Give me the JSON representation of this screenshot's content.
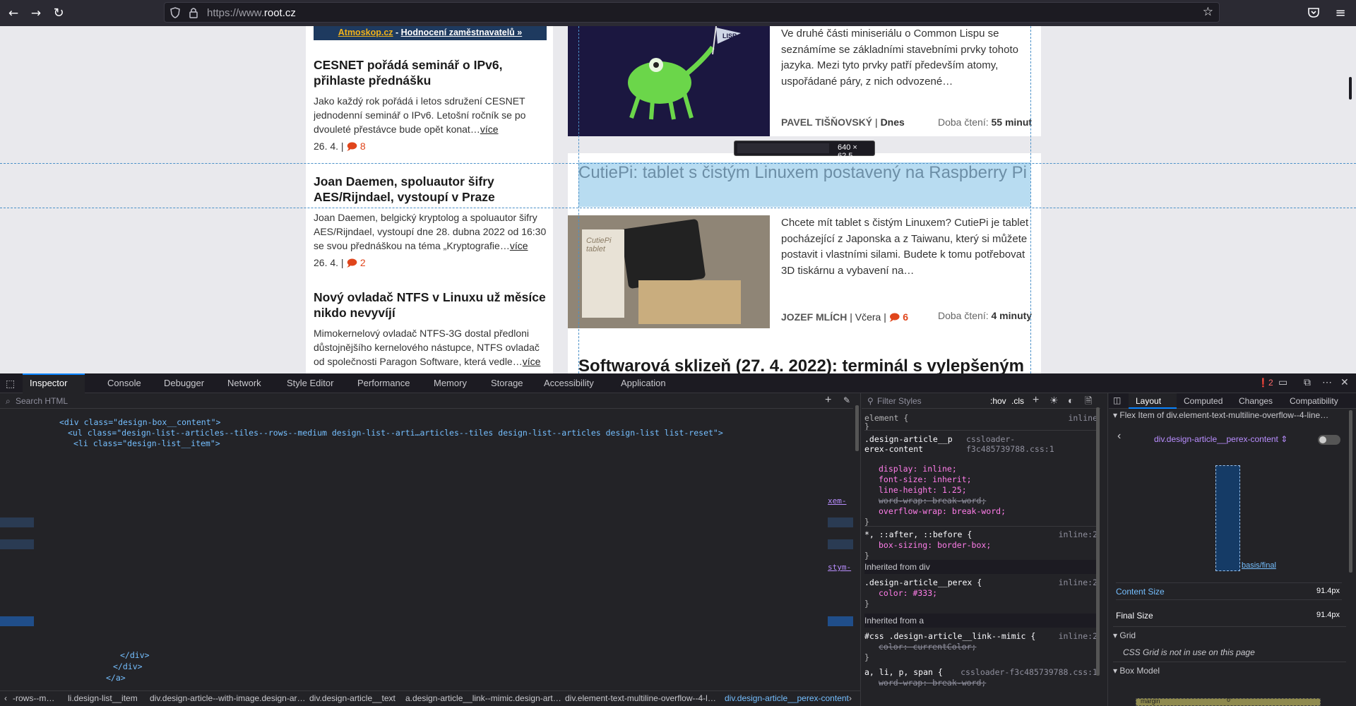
{
  "browser": {
    "url_prefix": "https://www.",
    "url_domain": "root.cz"
  },
  "page": {
    "promo": {
      "link1": "Atmoskop.cz",
      "sep": " - ",
      "link2": "Hodnocení zaměstnavatelů »"
    },
    "left_articles": [
      {
        "title": "CESNET pořádá seminář o IPv6, přihlaste přednášku",
        "perex": "Jako každý rok pořádá i letos sdružení CESNET jednodenní seminář o IPv6. Letošní ročník se po dvouleté přestávce bude opět konat…",
        "more": "více",
        "date": "26. 4.",
        "comments": "8"
      },
      {
        "title": "Joan Daemen, spoluautor šifry AES/Rijndael, vystoupí v Praze",
        "perex": "Joan Daemen, belgický kryptolog a spoluautor šifry AES/Rijndael, vystoupí dne 28. dubna 2022 od 16:30 se svou přednáškou na téma „Kryptografie…",
        "more": "více",
        "date": "26. 4.",
        "comments": "2"
      },
      {
        "title": "Nový ovladač NTFS v Linuxu už měsíce nikdo nevyvíjí",
        "perex": "Mimokernelový ovladač NTFS-3G dostal předloni důstojnějšího kernelového nástupce, NTFS ovladač od společnosti Paragon Software, která vedle…",
        "more": "více"
      }
    ],
    "main_articles": [
      {
        "perex": "Ve druhé části miniseriálu o Common Lispu se seznámíme se základními stavebními prvky tohoto jazyka. Mezi tyto prvky patří především atomy, uspořádané páry, z nich odvozené…",
        "author": "PAVEL TIŠŇOVSKÝ",
        "date": "Dnes",
        "read_label": "Doba čtení:",
        "read_time": "55 minut",
        "image_label": "LISP"
      },
      {
        "title": "CutiePi: tablet s čistým Linuxem postavený na Raspberry Pi",
        "perex": "Chcete mít tablet s čistým Linuxem? CutiePi je tablet pocházející z Japonska a z Taiwanu, který si můžete postavit i vlastními silami. Budete k tomu potřebovat 3D tiskárnu a vybavení na…",
        "author": "JOZEF MLÍCH",
        "date": "Včera",
        "comments": "6",
        "read_label": "Doba čtení:",
        "read_time": "4 minuty",
        "image_label": "CutiePi tablet"
      },
      {
        "title": "Softwarová sklizeň (27. 4. 2022): terminál s vylepšeným"
      }
    ],
    "tooltip_size": "640 × 62.5"
  },
  "devtools": {
    "tabs": [
      "Inspector",
      "Console",
      "Debugger",
      "Network",
      "Style Editor",
      "Performance",
      "Memory",
      "Storage",
      "Accessibility",
      "Application"
    ],
    "error_count": "2",
    "search_placeholder": "Search HTML",
    "filter_placeholder": "Filter Styles",
    "hov": ":hov",
    "cls": ".cls",
    "html_lines": [
      "<div class=\"design-box__content\">",
      "<ul class=\"design-list--articles--tiles--rows--medium design-list--arti…articles--tiles design-list--articles design-list list-reset\">",
      "<li class=\"design-list__item\">",
      "</div>",
      "</div>",
      "</a>"
    ],
    "html_side_snippets": [
      "xem-",
      "stym-"
    ],
    "breadcrumbs": [
      "-rows--m…",
      "li.design-list__item",
      "div.design-article--with-image.design-ar…",
      "div.design-article__text",
      "a.design-article__link--mimic.design-art…",
      "div.element-text-multiline-overflow--4-l…",
      "div.design-article__perex-content"
    ],
    "rules": {
      "element_sel": "element {",
      "element_src": "inline",
      "perex_sel": ".design-article__perex-content",
      "perex_src": "cssloader-f3c485739788.css:1",
      "perex_props": [
        "display: inline;",
        "font-size: inherit;",
        "line-height: 1.25;",
        "word-wrap: break-word;",
        "overflow-wrap: break-word;"
      ],
      "star_sel": "*, ::after, ::before {",
      "star_src": "inline:2",
      "star_prop": "box-sizing: border-box;",
      "inh_div": "Inherited from div",
      "perex2_sel": ".design-article__perex {",
      "perex2_src": "inline:2",
      "perex2_prop": "color: #333;",
      "inh_a": "Inherited from a",
      "mimic_sel": "#css .design-article__link--mimic {",
      "mimic_src": "inline:2",
      "mimic_prop": "color: currentColor;",
      "alip_sel": "a, li, p, span {",
      "alip_src": "cssloader-f3c485739788.css:1",
      "alip_prop": "word-wrap: break-word;"
    },
    "layout_tabs": [
      "Layout",
      "Computed",
      "Changes",
      "Compatibility"
    ],
    "flex_item_header": "Flex Item of div.element-text-multiline-overflow--4-line…",
    "flex_selector": "div.design-article__perex-content",
    "basis_label": "basis/final",
    "content_size_label": "Content Size",
    "content_size": "91.4px",
    "final_size_label": "Final Size",
    "final_size": "91.4px",
    "grid_header": "Grid",
    "grid_note": "CSS Grid is not in use on this page",
    "boxmodel_header": "Box Model",
    "margin_label": "margin",
    "margin_value": "0"
  }
}
